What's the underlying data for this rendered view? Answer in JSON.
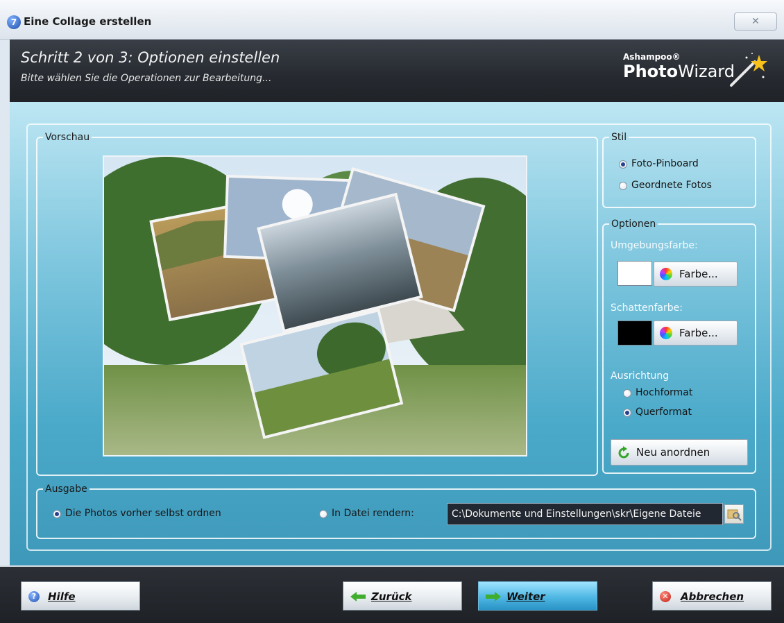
{
  "window": {
    "title": "Eine Collage erstellen",
    "icon_glyph": "7"
  },
  "header": {
    "step_title": "Schritt 2 von 3: Optionen einstellen",
    "step_subtitle": "Bitte wählen Sie die Operationen zur Bearbeitung...",
    "logo_brand": "Ashampoo®",
    "logo_name_bold": "Photo",
    "logo_name_rest": "Wizard"
  },
  "preview": {
    "legend": "Vorschau"
  },
  "style_group": {
    "legend": "Stil",
    "options": [
      {
        "label": "Foto-Pinboard",
        "selected": true
      },
      {
        "label": "Geordnete Fotos",
        "selected": false
      }
    ]
  },
  "options_group": {
    "legend": "Optionen",
    "surround_color_label": "Umgebungsfarbe:",
    "surround_color": "#ffffff",
    "shadow_color_label": "Schattenfarbe:",
    "shadow_color": "#000000",
    "color_button_label": "Farbe...",
    "orientation_label": "Ausrichtung",
    "orientations": [
      {
        "label": "Hochformat",
        "selected": false
      },
      {
        "label": "Querformat",
        "selected": true
      }
    ],
    "rearrange_button": "Neu anordnen"
  },
  "output_group": {
    "legend": "Ausgabe",
    "option_self_arrange": "Die Photos vorher selbst ordnen",
    "option_self_arrange_selected": true,
    "option_render_file": "In Datei rendern:",
    "option_render_file_selected": false,
    "path_value": "C:\\Dokumente und Einstellungen\\skr\\Eigene Dateie"
  },
  "footer": {
    "help": "Hilfe",
    "back": "Zurück",
    "next": "Weiter",
    "cancel": "Abbrechen"
  },
  "colors": {
    "header_bg": "#262a30",
    "main_bg_top": "#bde6f3",
    "main_bg_bottom": "#3e98b9",
    "primary_button": "#4fb7e3",
    "radio_dot": "#24408f"
  }
}
